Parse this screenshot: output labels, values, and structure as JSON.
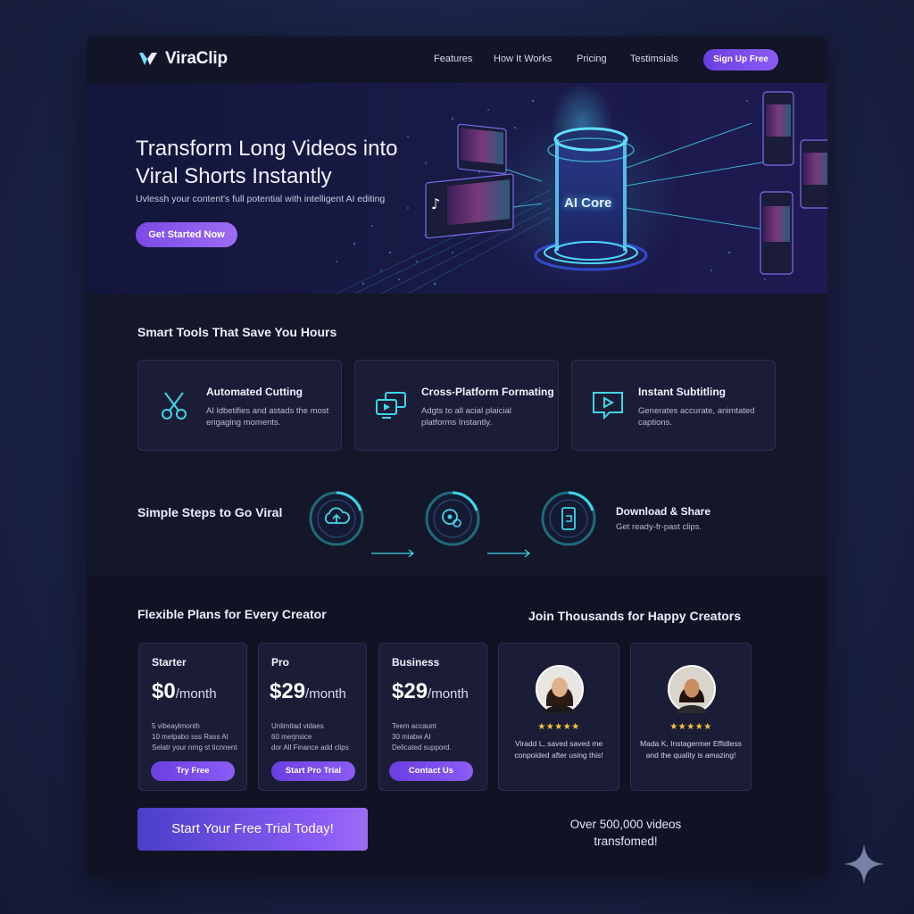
{
  "nav": {
    "brand": "ViraClip",
    "links": [
      "Features",
      "How It Works",
      "Pricing",
      "Testimsials"
    ],
    "signup_label": "Sign Up Free"
  },
  "hero": {
    "title": "Transform Long Videos into Viral Shorts Instantly",
    "subtitle": "Uvlessh your content's full potential with intelligent AI editing",
    "cta_label": "Get Started Now",
    "core_label": "AI Core"
  },
  "tools": {
    "title": "Smart Tools That Save You Hours",
    "features": [
      {
        "title": "Automated Cutting",
        "desc": "AI ldbetifies and astads the most engaging moments.",
        "icon": "scissors-icon"
      },
      {
        "title": "Cross-Platform Formating",
        "desc": "Adgts to all acial plaicial platforms Instantly.",
        "icon": "multi-screen-icon"
      },
      {
        "title": "Instant Subtitling",
        "desc": "Generates accurate, animtated captions.",
        "icon": "caption-bubble-icon"
      }
    ]
  },
  "steps": {
    "title": "Simple Steps to Go Viral",
    "icons": [
      "upload-cloud-icon",
      "ai-process-icon",
      "mobile-share-icon"
    ],
    "final_title": "Download & Share",
    "final_desc": "Get ready-fr-past clips."
  },
  "pricing": {
    "title": "Flexible Plans for Every Creator",
    "plans": [
      {
        "name": "Starter",
        "price": "$0",
        "per": "/month",
        "features": [
          "5 vibeaylmonth",
          "10 melpabo sss Rass AI",
          "Selatr your nrng st ticnnent"
        ],
        "button": "Try Free"
      },
      {
        "name": "Pro",
        "price": "$29",
        "per": "/month",
        "features": [
          "Unlimitad vidaes",
          "60 merjnsice",
          "dor All Finance add clips"
        ],
        "button": "Start Pro Trial"
      },
      {
        "name": "Business",
        "price": "$29",
        "per": "/month",
        "features": [
          "Teem accaunt",
          "30 miabw AI",
          "Delicated suppord."
        ],
        "button": "Contact Us"
      }
    ]
  },
  "testimonials": {
    "title": "Join Thousands for Happy Creators",
    "items": [
      {
        "stars": "★★★★★",
        "quote": "Viradd L, saved saved me conpoided after using this!"
      },
      {
        "stars": "★★★★★",
        "quote": "Mada K, Instagermer Effidless and the quality is amazing!"
      }
    ]
  },
  "footer": {
    "cta_label": "Start Your Free Trial Today!",
    "stat": "Over 500,000 videos transfomed!"
  },
  "colors": {
    "accent": "#8b5cf6",
    "cyan": "#3fd6e6",
    "background": "#131529",
    "star": "#f5c542"
  }
}
